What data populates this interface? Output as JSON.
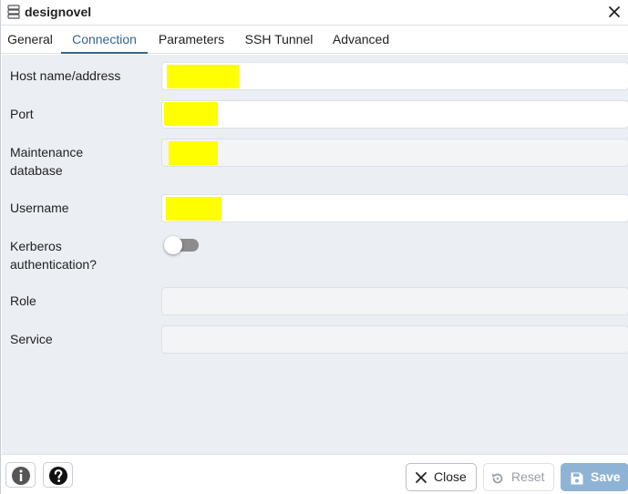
{
  "window": {
    "title": "designovel",
    "title_icon": "server-icon",
    "close_icon": "close-icon"
  },
  "tabs": [
    {
      "label": "General",
      "active": false
    },
    {
      "label": "Connection",
      "active": true
    },
    {
      "label": "Parameters",
      "active": false
    },
    {
      "label": "SSH Tunnel",
      "active": false
    },
    {
      "label": "Advanced",
      "active": false
    }
  ],
  "form": {
    "host": {
      "label": "Host name/address",
      "value": "",
      "redacted": true,
      "disabled": false
    },
    "port": {
      "label": "Port",
      "value": "",
      "redacted": true,
      "disabled": false
    },
    "maintenance_db": {
      "label_line1": "Maintenance",
      "label_line2": "database",
      "value": "",
      "redacted": true,
      "disabled": true
    },
    "username": {
      "label": "Username",
      "value": "",
      "redacted": true,
      "disabled": false
    },
    "kerberos": {
      "label_line1": "Kerberos",
      "label_line2": "authentication?",
      "enabled": false
    },
    "role": {
      "label": "Role",
      "value": "",
      "disabled": true
    },
    "service": {
      "label": "Service",
      "value": "",
      "disabled": true
    }
  },
  "footer": {
    "info_icon": "info-icon",
    "help_icon": "help-icon",
    "close_label": "Close",
    "reset_label": "Reset",
    "save_label": "Save"
  },
  "colors": {
    "accent": "#326690",
    "form_bg": "#ebeef3",
    "redaction": "#ffff00",
    "save_bg": "#8fb3d5"
  }
}
